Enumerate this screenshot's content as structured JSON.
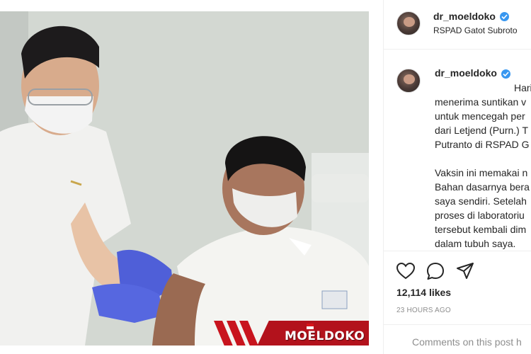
{
  "post": {
    "photo_alt": "",
    "banner_name": "MOELDOKO"
  },
  "header": {
    "username": "dr_moeldoko",
    "location": "RSPAD Gatot Subroto"
  },
  "caption": {
    "username": "dr_moeldoko",
    "text": "Hari\nmenerima suntikan v\nuntuk mencegah per\ndari Letjend (Purn.) T\nPutranto di RSPAD G\n\nVaksin ini memakai n\nBahan dasarnya bera\nsaya sendiri. Setelah\nproses di laboratoriu\ntersebut kembali dim\ndalam tubuh saya.\n\nSelanjutnya, sel-sel d"
  },
  "actions": {
    "like_icon": "heart-icon",
    "comment_icon": "comment-icon",
    "share_icon": "paper-plane-icon"
  },
  "likes": "12,114 likes",
  "time": "23 HOURS AGO",
  "comments_disabled": "Comments on this post h",
  "colors": {
    "verified": "#3897f0",
    "banner_red": "#b3121c",
    "muted": "#8e8e8e"
  }
}
